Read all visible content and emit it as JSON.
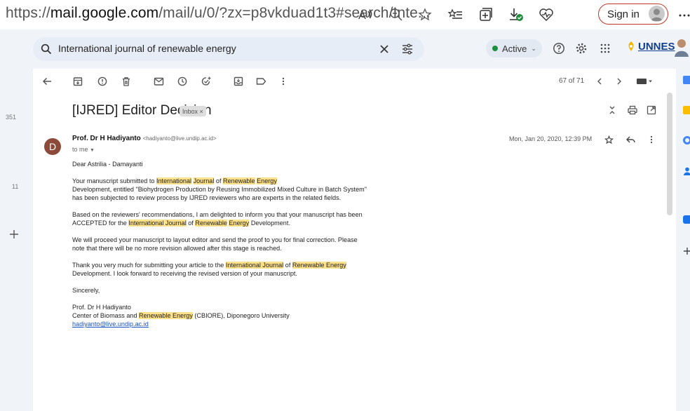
{
  "browser": {
    "url_prefix": "https://",
    "url_domain": "mail.google.com",
    "url_path": "/mail/u/0/?zx=p8vkduad1t3#search/Inte...",
    "sign_in_label": "Sign in"
  },
  "gmail": {
    "search_query": "International journal of renewable energy",
    "status_label": "Active",
    "org_logo_text": "UNNES"
  },
  "rail": {
    "count_top": "351",
    "count_mid": "11"
  },
  "toolbar": {
    "page_count": "67 of 71"
  },
  "email": {
    "subject": "[IJRED] Editor Decision",
    "label_chip": "Inbox ×",
    "sender_initial": "D",
    "sender_name": "Prof. Dr H Hadiyanto",
    "sender_email": "<hadiyanto@live.undip.ac.id>",
    "to_me": "to me",
    "date": "Mon, Jan 20, 2020, 12:39 PM",
    "greeting": "Dear Astrilia - Damayanti",
    "p1_a": "Your manuscript submitted to ",
    "p1_hl1": "International",
    "p1_hl2": "Journal",
    "p1_of": "of",
    "p1_hl3": "Renewable",
    "p1_hl4": "Energy",
    "p1_b": "Development, entitled \"Biohydrogen Production by Reusing Immobilized Mixed Culture in Batch System\" has been subjected to review process by IJRED reviewers who are experts in the related fields.",
    "p2_a": "Based on the reviewers' recommendations, I am delighted to inform you that your manuscript has been ACCEPTED for the ",
    "p2_hl1": "International Journal",
    "p2_of": "of",
    "p2_hl2": "Renewable",
    "p2_hl3": "Energy",
    "p2_b": "Development.",
    "p3": "We will proceed your manuscript to layout editor and send the proof to you for final correction. Please note that there will be no more revision allowed after this stage is reached.",
    "p4_a": "Thank you very much for submitting your article to the ",
    "p4_hl1": "International Journal",
    "p4_of": "of",
    "p4_hl2": "Renewable Energy",
    "p4_b": "Development.  I look forward to receiving the revised version of your manuscript.",
    "closing": "Sincerely,",
    "sig_name": "Prof. Dr H Hadiyanto",
    "sig_center_a": "Center of Biomass and ",
    "sig_hl": "Renewable Energy",
    "sig_center_b": " (CBIORE), Diponegoro University",
    "sig_email": "hadiyanto@live.undip.ac.id"
  },
  "colors": {
    "highlight": "#fce08a",
    "link": "#1a55c8",
    "avatar": "#8b4a3a",
    "active_dot": "#1e8e3e"
  }
}
